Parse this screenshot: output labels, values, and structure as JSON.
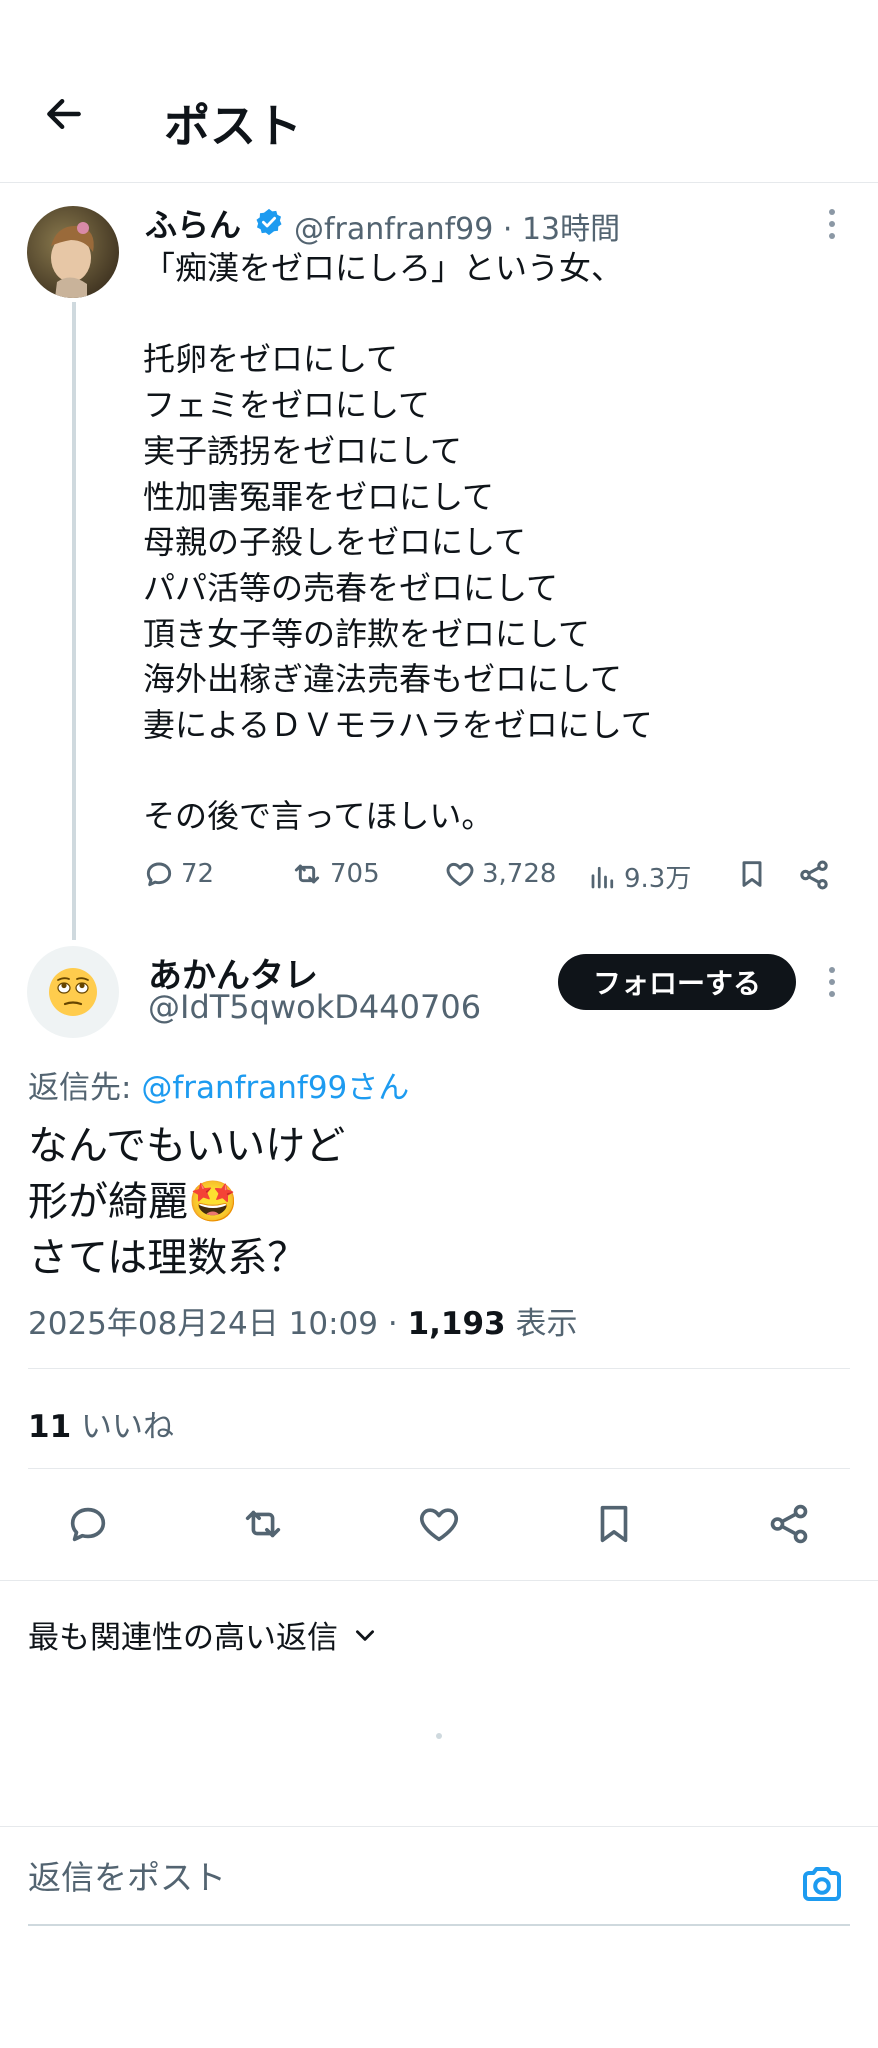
{
  "header": {
    "title": "ポスト",
    "back_icon": "arrow-left-icon"
  },
  "post1": {
    "author_name": "ふらん",
    "verified": true,
    "handle": "@franfranf99",
    "separator": "·",
    "time": "13時間",
    "text": "「痴漢をゼロにしろ」という女、\n\n托卵をゼロにして\nフェミをゼロにして\n実子誘拐をゼロにして\n性加害冤罪をゼロにして\n母親の子殺しをゼロにして\nパパ活等の売春をゼロにして\n頂き女子等の詐欺をゼロにして\n海外出稼ぎ違法売春もゼロにして\n妻によるＤＶモラハラをゼロにして\n\nその後で言ってほしい。",
    "stats": {
      "replies": "72",
      "reposts": "705",
      "likes": "3,728",
      "views": "9.3万"
    }
  },
  "post2": {
    "author_name": "あかんタレ",
    "handle": "@IdT5qwokD440706",
    "follow_label": "フォローする",
    "reply_to_label": "返信先: ",
    "reply_to_mention": "@franfranf99さん",
    "text": "なんでもいいけど\n形が綺麗🤩\nさては理数系？",
    "date": "2025年08月24日 10:09",
    "separator": "·",
    "views_count": "1,193",
    "views_label": "表示",
    "likes_count": "11",
    "likes_label": "いいね"
  },
  "replies_sort": {
    "label": "最も関連性の高い返信"
  },
  "composer": {
    "placeholder": "返信をポスト"
  },
  "colors": {
    "accent": "#1d9bf0",
    "text": "#0f1419",
    "secondary": "#536471",
    "border": "#e6e9ec"
  }
}
